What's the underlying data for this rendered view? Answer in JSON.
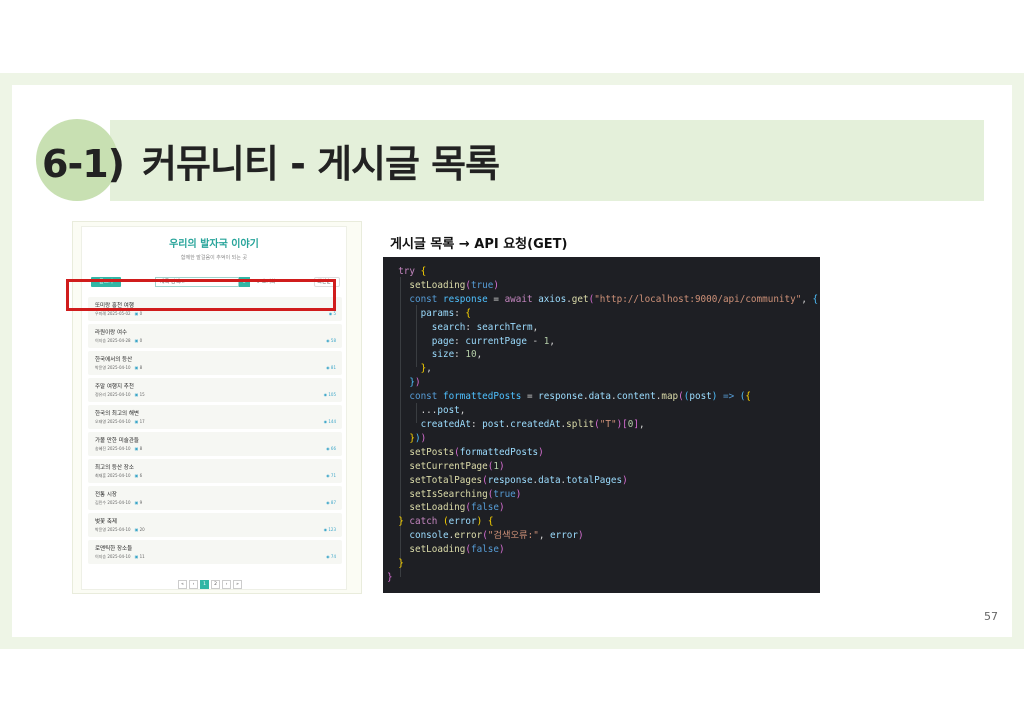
{
  "slide": {
    "number": "6-1)",
    "title": "커뮤니티 - 게시글 목록",
    "page_number": "57"
  },
  "app": {
    "title": "우리의 발자국 이야기",
    "subtitle": "함께한 발걸음이 추억이 되는 곳",
    "write_label": "글쓰기",
    "search_placeholder": "제목 검색...",
    "search_icon": "search-icon",
    "reset_label": "↻ 초기화",
    "sort_label": "최신순 ⌄",
    "posts": [
      {
        "title": "또미랑 홍천 여행",
        "author": "우미례",
        "date": "2025-05-02",
        "comments": "0",
        "views": "5"
      },
      {
        "title": "라원이랑 여수",
        "author": "이지승",
        "date": "2025-04-28",
        "comments": "0",
        "views": "58"
      },
      {
        "title": "한국에서의 등산",
        "author": "박윤영",
        "date": "2025-04-10",
        "comments": "8",
        "views": "81"
      },
      {
        "title": "주말 여행지 추천",
        "author": "정유리",
        "date": "2025-04-10",
        "comments": "15",
        "views": "105"
      },
      {
        "title": "한국의 최고의 해변",
        "author": "오태영",
        "date": "2025-04-10",
        "comments": "17",
        "views": "144"
      },
      {
        "title": "가볼 만한 미술관들",
        "author": "송혜진",
        "date": "2025-04-10",
        "comments": "8",
        "views": "66"
      },
      {
        "title": "최고의 등산 장소",
        "author": "최재훈",
        "date": "2025-04-10",
        "comments": "6",
        "views": "71"
      },
      {
        "title": "전통 시장",
        "author": "김민수",
        "date": "2025-04-10",
        "comments": "9",
        "views": "87"
      },
      {
        "title": "벚꽃 축제",
        "author": "박윤영",
        "date": "2025-04-10",
        "comments": "20",
        "views": "123"
      },
      {
        "title": "로맨틱한 장소들",
        "author": "이지승",
        "date": "2025-04-10",
        "comments": "11",
        "views": "74"
      }
    ],
    "pagination": [
      "«",
      "‹",
      "1",
      "2",
      "›",
      "»"
    ],
    "active_page": "1"
  },
  "code": {
    "heading": "게시글 목록 → API 요청(GET)",
    "url": "\"http://localhost:9000/api/community\"",
    "error_msg": "\"검색오류:\"",
    "split_char": "\"T\""
  }
}
